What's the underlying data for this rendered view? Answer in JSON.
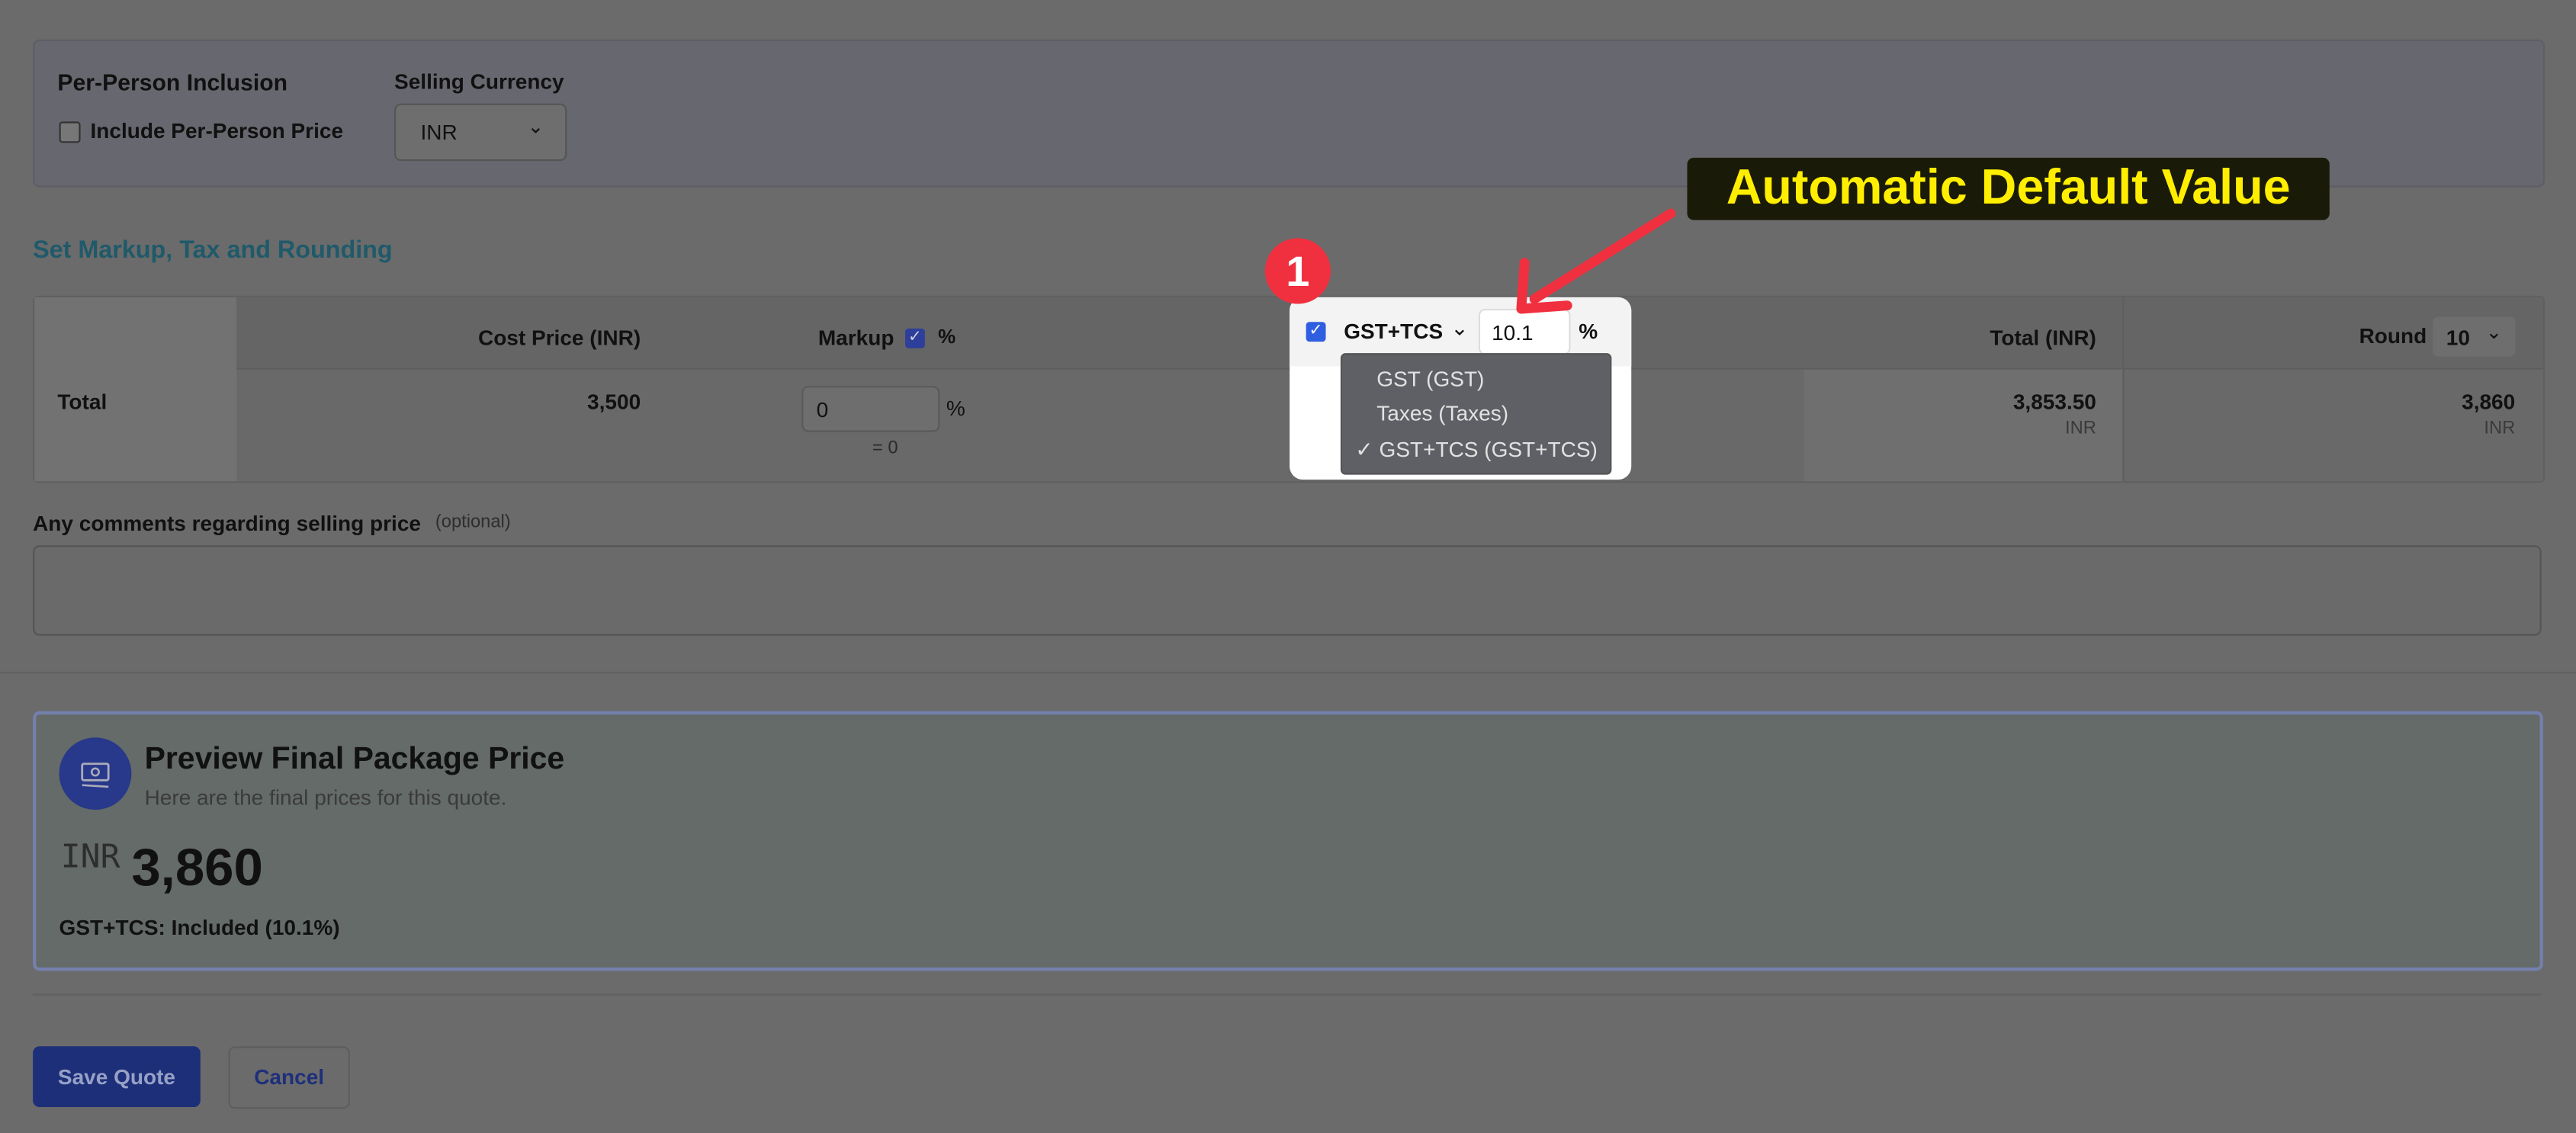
{
  "per_person": {
    "heading": "Per-Person Inclusion",
    "checkbox_label": "Include Per-Person Price",
    "checked": false
  },
  "currency": {
    "label": "Selling Currency",
    "value": "INR"
  },
  "section_title": "Set Markup, Tax and Rounding",
  "table": {
    "headers": {
      "cost": "Cost Price (INR)",
      "markup": "Markup",
      "markup_unit": "%",
      "tax_name": "GST+TCS",
      "tax_value": "10.1",
      "tax_unit": "%",
      "total": "Total (INR)",
      "round": "Round",
      "round_value": "10"
    },
    "row": {
      "label": "Total",
      "cost": "3,500",
      "markup_value": "0",
      "markup_unit": "%",
      "markup_eq": "= 0",
      "total": "3,853.50",
      "total_currency": "INR",
      "rounded": "3,860",
      "rounded_currency": "INR"
    },
    "tax_options": [
      {
        "label": "GST (GST)",
        "selected": false
      },
      {
        "label": "Taxes (Taxes)",
        "selected": false
      },
      {
        "label": "✓ GST+TCS (GST+TCS)",
        "selected": true
      }
    ]
  },
  "comments": {
    "label": "Any comments regarding selling price",
    "optional": "(optional)",
    "value": ""
  },
  "preview": {
    "title": "Preview Final Package Price",
    "subtitle": "Here are the final prices for this quote.",
    "currency": "INR",
    "amount": "3,860",
    "tax_note": "GST+TCS: Included (10.1%)",
    "icon": "money-icon"
  },
  "actions": {
    "save": "Save Quote",
    "cancel": "Cancel"
  },
  "annotation": {
    "badge": "1",
    "label": "Automatic Default Value",
    "label_color": "#ffee00",
    "arrow_color": "#f0303f"
  },
  "colors": {
    "primary": "#1e2f7a",
    "section_title": "#1f5a6a"
  }
}
